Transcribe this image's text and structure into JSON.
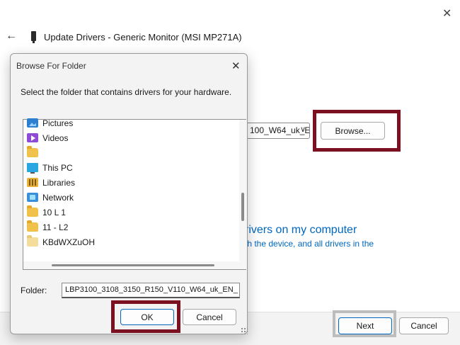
{
  "wizard": {
    "title": "Update Drivers - Generic Monitor (MSI MP271A)",
    "path_combo_value": "100_W64_uk_E",
    "browse_label": "Browse...",
    "link_heading": "rivers on my computer",
    "link_sub": "th the device, and all drivers in the",
    "next_label": "Next",
    "cancel_label": "Cancel"
  },
  "dialog": {
    "title": "Browse For Folder",
    "instruction": "Select the folder that contains drivers for your hardware.",
    "tree_items": [
      {
        "label": "Pictures",
        "icon": "pictures-icon"
      },
      {
        "label": "Videos",
        "icon": "videos-icon"
      },
      {
        "label": "",
        "icon": "folder-icon"
      },
      {
        "label": "This PC",
        "icon": "this-pc-icon"
      },
      {
        "label": "Libraries",
        "icon": "libraries-icon"
      },
      {
        "label": "Network",
        "icon": "network-icon"
      },
      {
        "label": "10 L 1",
        "icon": "folder-icon"
      },
      {
        "label": "11 - L2",
        "icon": "folder-icon"
      },
      {
        "label": "KBdWXZuOH",
        "icon": "folder-icon"
      }
    ],
    "folder_label": "Folder:",
    "folder_value": "LBP3100_3108_3150_R150_V110_W64_uk_EN_",
    "ok_label": "OK",
    "cancel_label": "Cancel"
  },
  "colors": {
    "highlight_red": "#7a1020",
    "highlight_gray": "#bdbdbd",
    "link_blue": "#0067c0"
  }
}
